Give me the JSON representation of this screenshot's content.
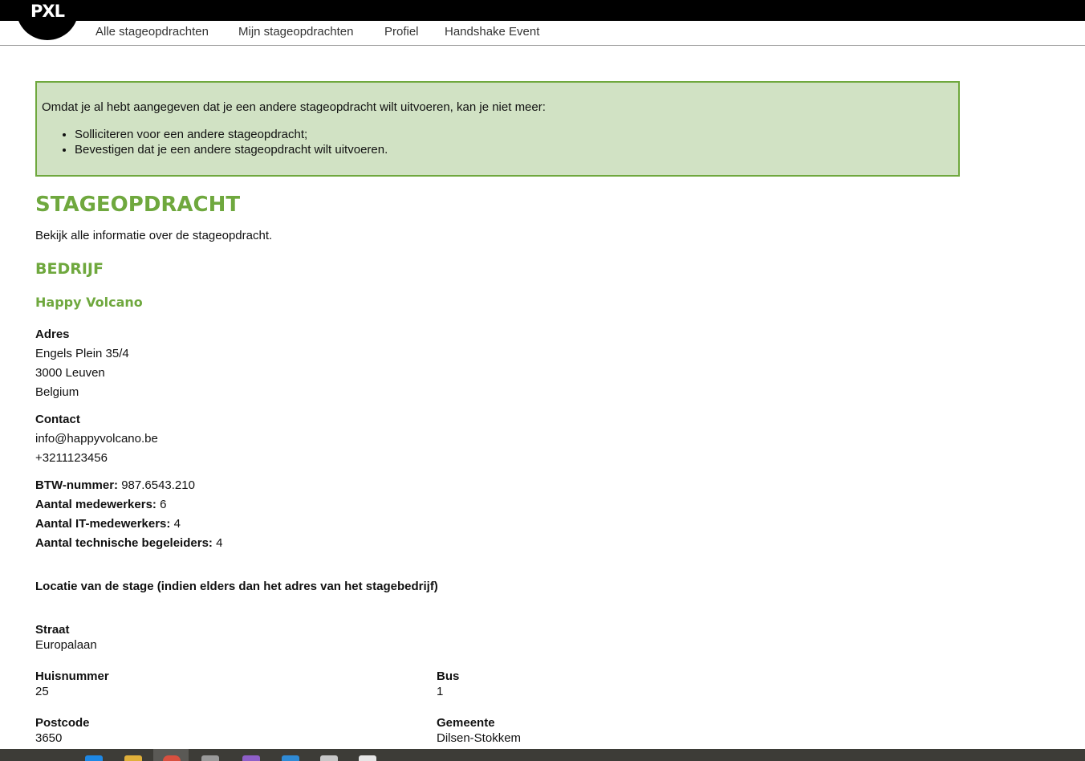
{
  "logo": {
    "text": "PXL"
  },
  "nav": {
    "items": [
      {
        "label": "Alle stageopdrachten"
      },
      {
        "label": "Mijn stageopdrachten"
      },
      {
        "label": "Profiel"
      },
      {
        "label": "Handshake Event"
      }
    ]
  },
  "alert": {
    "text": "Omdat je al hebt aangegeven dat je een andere stageopdracht wilt uitvoeren, kan je niet meer:",
    "items": [
      "Solliciteren voor een andere stageopdracht;",
      "Bevestigen dat je een andere stageopdracht wilt uitvoeren."
    ]
  },
  "page": {
    "title": "STAGEOPDRACHT",
    "subtitle": "Bekijk alle informatie over de stageopdracht."
  },
  "company": {
    "section_title": "BEDRIJF",
    "name": "Happy Volcano",
    "address_label": "Adres",
    "address": [
      "Engels Plein 35/4",
      "3000 Leuven",
      "Belgium"
    ],
    "contact_label": "Contact",
    "contact": [
      "info@happyvolcano.be",
      "+3211123456"
    ],
    "facts": [
      {
        "label": "BTW-nummer:",
        "value": "987.6543.210"
      },
      {
        "label": "Aantal medewerkers:",
        "value": "6"
      },
      {
        "label": "Aantal IT-medewerkers:",
        "value": "4"
      },
      {
        "label": "Aantal technische begeleiders:",
        "value": "4"
      }
    ]
  },
  "location": {
    "heading": "Locatie van de stage (indien elders dan het adres van het stagebedrijf)",
    "street_label": "Straat",
    "street": "Europalaan",
    "number_label": "Huisnummer",
    "number": "25",
    "bus_label": "Bus",
    "bus": "1",
    "postcode_label": "Postcode",
    "postcode": "3650",
    "city_label": "Gemeente",
    "city": "Dilsen-Stokkem"
  },
  "colors": {
    "accent": "#6fa83e",
    "alert_bg": "#d1e2c4",
    "topbar": "#000000"
  }
}
